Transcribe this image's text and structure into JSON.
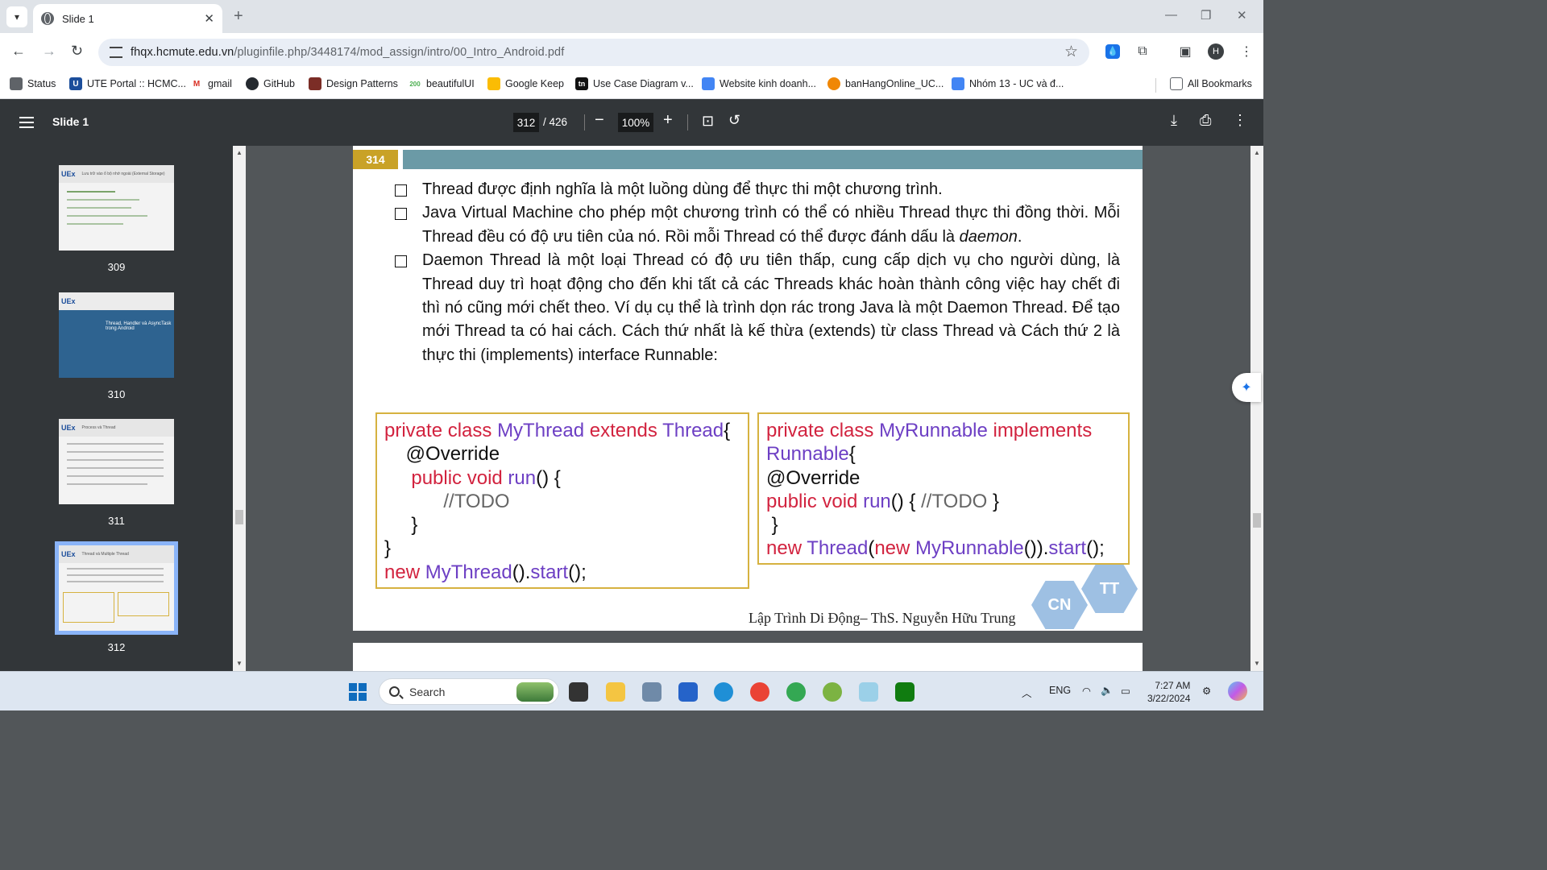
{
  "browser": {
    "tab_title": "Slide 1",
    "url_host": "fhqx.hcmute.edu.vn",
    "url_path": "/pluginfile.php/3448174/mod_assign/intro/00_Intro_Android.pdf",
    "profile_initial": "H"
  },
  "bookmarks": [
    {
      "label": "Status",
      "icon": "document-icon",
      "color": "#5f6368"
    },
    {
      "label": "UTE Portal :: HCMC...",
      "icon": "ute-icon",
      "color": "#1c4e9b"
    },
    {
      "label": "gmail",
      "icon": "gmail-icon",
      "color": "#d93025"
    },
    {
      "label": "GitHub",
      "icon": "github-icon",
      "color": "#24292f"
    },
    {
      "label": "Design Patterns",
      "icon": "refactoring-icon",
      "color": "#7b2d26"
    },
    {
      "label": "beautifulUI",
      "icon": "ui-icon",
      "color": "#4caf50"
    },
    {
      "label": "Google Keep",
      "icon": "keep-icon",
      "color": "#fbbc04"
    },
    {
      "label": "Use Case Diagram v...",
      "icon": "tn-icon",
      "color": "#111111"
    },
    {
      "label": "Website kinh doanh...",
      "icon": "docs-icon",
      "color": "#4285f4"
    },
    {
      "label": "banHangOnline_UC...",
      "icon": "drawio-icon",
      "color": "#f08705"
    },
    {
      "label": "Nhóm 13 - UC và đ...",
      "icon": "docs-icon",
      "color": "#4285f4"
    }
  ],
  "all_bookmarks_label": "All Bookmarks",
  "pdf_toolbar": {
    "title": "Slide 1",
    "current_page": "312",
    "total_pages": "/ 426",
    "zoom": "100%"
  },
  "thumbnails": [
    {
      "number": "309",
      "title": "Lưu trữ vào ổ bộ nhớ ngoài (External Storage)",
      "selected": false
    },
    {
      "number": "310",
      "title": "Thread, Handler và AsyncTask trong Android",
      "selected": false
    },
    {
      "number": "311",
      "title": "Process và Thread",
      "selected": false
    },
    {
      "number": "312",
      "title": "Thread và Multiple Thread",
      "selected": true
    }
  ],
  "slide": {
    "page_number": "314",
    "bullets": [
      "Thread được định nghĩa là một luồng dùng để thực thi một chương trình.",
      "Java Virtual Machine cho phép một chương trình có thể có nhiều Thread thực thi đồng thời. Mỗi Thread đều có độ ưu tiên của nó. Rồi mỗi Thread có thể được đánh dấu là ",
      "Daemon Thread là một loại Thread có độ ưu tiên thấp, cung cấp dịch vụ cho người dùng, là Thread duy trì hoạt động cho đến khi tất cả các Threads khác hoàn thành công việc hay chết đi thì nó cũng mới chết theo. Ví dụ cụ thể là trình dọn rác trong Java là một Daemon Thread. Để tạo mới Thread ta có hai cách. Cách thứ nhất là kế thừa (extends) từ class Thread và Cách thứ 2 là thực thi (implements) interface Runnable:"
    ],
    "bullet2_italic": "daemon",
    "bullet2_end": ".",
    "code_left": {
      "l1_kw": "private class ",
      "l1_ty": "MyThread",
      "l1_kw2": " extends ",
      "l1_ty2": "Thread",
      "l1_p": "{",
      "l2": "@Override",
      "l3_kw": "public void ",
      "l3_ty": "run",
      "l3_p": "() {",
      "l4": "//TODO",
      "l5": "}",
      "l6": "}",
      "l7_kw": "new ",
      "l7_ty": "MyThread",
      "l7_p": "().",
      "l7_ty2": "start",
      "l7_p2": "();"
    },
    "code_right": {
      "l1_kw": "private class ",
      "l1_ty": "MyRunnable",
      "l1_kw2": " implements",
      "l2_ty": "Runnable",
      "l2_p": "{",
      "l3": "@Override",
      "l4_kw": "public void ",
      "l4_ty": "run",
      "l4_p": "() { ",
      "l4_cm": "//TODO",
      "l4_p2": " }",
      "l5": " }",
      "l6_kw": "new ",
      "l6_ty": "Thread",
      "l6_p": "(",
      "l6_kw2": "new ",
      "l6_ty2": "MyRunnable",
      "l6_p2": "()).",
      "l6_ty3": "start",
      "l6_p3": "();"
    },
    "footer": "Lập Trình Di Động– ThS. Nguyễn Hữu Trung",
    "hex_left": "CN",
    "hex_right": "TT"
  },
  "taskbar": {
    "search_label": "Search",
    "language": "ENG",
    "time": "7:27 AM",
    "date": "3/22/2024"
  }
}
